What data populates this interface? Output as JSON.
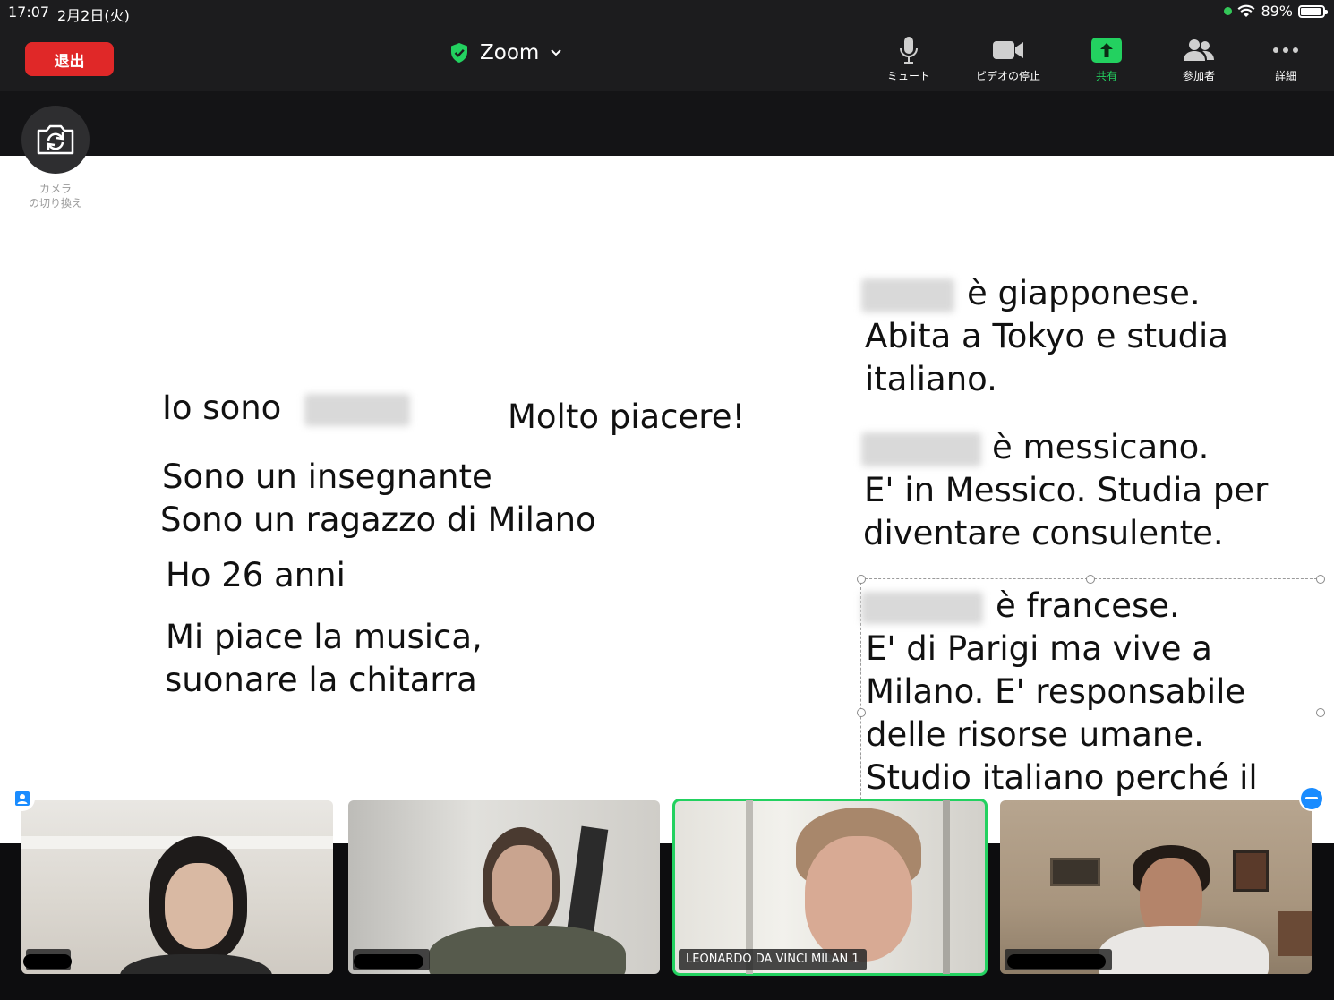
{
  "status_bar": {
    "time": "17:07",
    "date": "2月2日(火)",
    "battery": "89%"
  },
  "toolbar": {
    "leave_label": "退出",
    "meeting_title": "Zoom",
    "buttons": [
      {
        "label": "ミュート",
        "icon": "microphone-icon"
      },
      {
        "label": "ビデオの停止",
        "icon": "video-camera-icon"
      },
      {
        "label": "共有",
        "icon": "share-icon"
      },
      {
        "label": "参加者",
        "icon": "participants-icon"
      },
      {
        "label": "詳細",
        "icon": "more-icon"
      }
    ],
    "accent_color": "#23d160",
    "leave_color": "#e02828"
  },
  "camera_switch": {
    "label_line1": "カメラ",
    "label_line2": "の切り換え"
  },
  "slide": {
    "left": {
      "io_sono": "Io sono",
      "molto_piacere": "Molto piacere!",
      "line1": "Sono un insegnante",
      "line2": "Sono un ragazzo di Milano",
      "age": "Ho 26 anni",
      "hobby1": "Mi piace la musica,",
      "hobby2": "suonare la chitarra"
    },
    "right": {
      "p1_l1": "è giapponese.",
      "p1_l2": "Abita a Tokyo e studia",
      "p1_l3": "italiano.",
      "p2_l1": "è messicano.",
      "p2_l2": "E' in Messico. Studia per",
      "p2_l3": "diventare consulente.",
      "p3_l1": "è francese.",
      "p3_l2": "E' di Parigi ma vive a",
      "p3_l3": "Milano. E' responsabile",
      "p3_l4": "delle risorse umane.",
      "p3_l5": "Studio italiano perché il"
    }
  },
  "videos": [
    {
      "name": ""
    },
    {
      "name": ""
    },
    {
      "name": "LEONARDO DA VINCI MILAN 1"
    },
    {
      "name": ""
    }
  ]
}
